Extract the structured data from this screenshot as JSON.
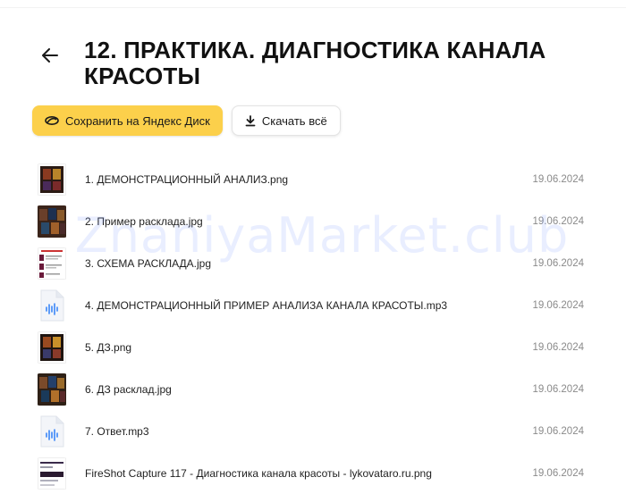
{
  "header": {
    "title": "12. ПРАКТИКА. ДИАГНОСТИКА КАНАЛА КРАСОТЫ"
  },
  "actions": {
    "save_label": "Сохранить на Яндекс Диск",
    "download_label": "Скачать всё"
  },
  "watermark": "ZnaniyaMarket.club",
  "files": [
    {
      "name": "1. ДЕМОНСТРАЦИОННЫЙ АНАЛИЗ.png",
      "date": "19.06.2024",
      "icon": "dark-card-image"
    },
    {
      "name": "2. Пример расклада.jpg",
      "date": "19.06.2024",
      "icon": "spread-photo"
    },
    {
      "name": "3. СХЕМА РАСКЛАДА.jpg",
      "date": "19.06.2024",
      "icon": "scheme-image"
    },
    {
      "name": "4. ДЕМОНСТРАЦИОННЫЙ ПРИМЕР АНАЛИЗА КАНАЛА КРАСОТЫ.mp3",
      "date": "19.06.2024",
      "icon": "audio-file"
    },
    {
      "name": "5. ДЗ.png",
      "date": "19.06.2024",
      "icon": "dark-card-image"
    },
    {
      "name": "6. ДЗ расклад.jpg",
      "date": "19.06.2024",
      "icon": "spread-photo"
    },
    {
      "name": "7. Ответ.mp3",
      "date": "19.06.2024",
      "icon": "audio-file"
    },
    {
      "name": "FireShot Capture 117 - Диагностика канала красоты - lykovataro.ru.png",
      "date": "19.06.2024",
      "icon": "screenshot-image"
    }
  ],
  "colors": {
    "accent": "#fcd04b",
    "date_text": "#8a8a8a",
    "audio_icon": "#3a86f7"
  }
}
